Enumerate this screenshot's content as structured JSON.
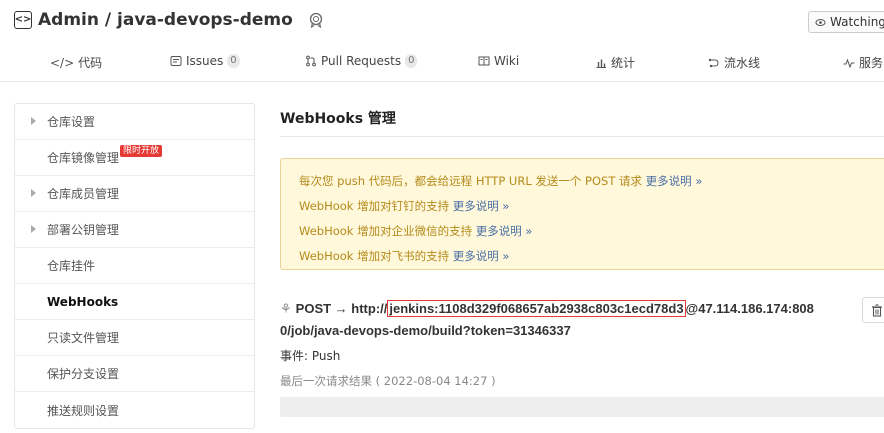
{
  "repo": {
    "title": "Admin / java-devops-demo",
    "watch_label": "Watching"
  },
  "nav": [
    {
      "label": "代码",
      "icon": "code-icon",
      "count": null
    },
    {
      "label": "Issues",
      "icon": "issues-icon",
      "count": "0"
    },
    {
      "label": "Pull Requests",
      "icon": "pull-request-icon",
      "count": "0"
    },
    {
      "label": "Wiki",
      "icon": "wiki-icon",
      "count": null
    },
    {
      "label": "统计",
      "icon": "stats-icon",
      "count": null
    },
    {
      "label": "流水线",
      "icon": "pipeline-icon",
      "count": null
    },
    {
      "label": "服务",
      "icon": "service-icon",
      "count": null
    }
  ],
  "sidebar": {
    "items": [
      {
        "label": "仓库设置",
        "expandable": true
      },
      {
        "label": "仓库镜像管理",
        "tag": "限时开放"
      },
      {
        "label": "仓库成员管理",
        "expandable": true
      },
      {
        "label": "部署公钥管理",
        "expandable": true
      },
      {
        "label": "仓库挂件"
      },
      {
        "label": "WebHooks",
        "active": true
      },
      {
        "label": "只读文件管理"
      },
      {
        "label": "保护分支设置"
      },
      {
        "label": "推送规则设置"
      }
    ]
  },
  "main": {
    "title": "WebHooks 管理",
    "notices": [
      {
        "text": "每次您 push 代码后，都会给远程 HTTP URL 发送一个 POST 请求 ",
        "link": "更多说明 »"
      },
      {
        "text": "WebHook 增加对钉钉的支持 ",
        "link": "更多说明 »"
      },
      {
        "text": "WebHook 增加对企业微信的支持 ",
        "link": "更多说明 »"
      },
      {
        "text": "WebHook 增加对飞书的支持 ",
        "link": "更多说明 »"
      }
    ],
    "hook": {
      "prefix": "POST → http://",
      "highlight": "jenkins:1108d329f068657ab2938c803c1ecd78d3",
      "suffix": "@47.114.186.174:808",
      "line2": "0/job/java-devops-demo/build?token=31346337",
      "event": "事件:  Push",
      "last_result": "最后一次请求结果 ( 2022-08-04 14:27 )"
    }
  },
  "colors": {
    "notice_bg": "#fff8db",
    "notice_text": "#b58a1b",
    "link": "#4a6fa5",
    "highlight_border": "#e53935",
    "tag_bg": "#e53935"
  }
}
